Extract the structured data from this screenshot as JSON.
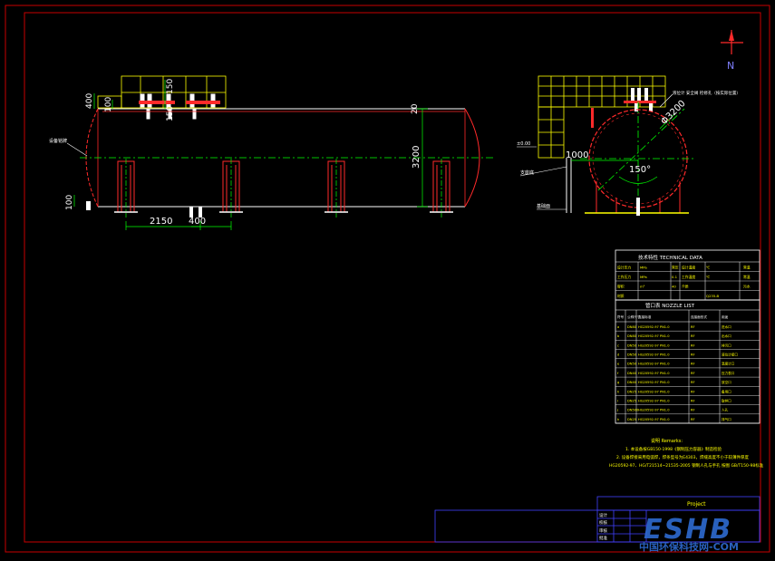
{
  "colors": {
    "background": "#000000",
    "frame": "#c80000",
    "vessel": "#ffffff",
    "support": "#ff2a2a",
    "dimension": "#00ff00",
    "table": "#ffff00",
    "centerline": "#00ff00",
    "north": "#ff2a2a",
    "text": "#ffffff",
    "watermark": "#2e6bd1"
  },
  "north": {
    "label": "N"
  },
  "side_view": {
    "dim_400_left": "400",
    "dim_100_top": "100",
    "dim_150_a": "150",
    "dim_150_b": "150",
    "dim_20": "20",
    "dim_3200": "3200",
    "dim_100_bottom": "100",
    "dim_2150": "2150",
    "dim_400_bottom": "400",
    "left_note": "设备铭牌"
  },
  "end_view": {
    "dim_diameter": "Φ3200",
    "dim_1000": "1000",
    "angle": "150°",
    "top_note": "液位计  安全阀  检修孔（按实际位置）",
    "left_note_a": "±0.00",
    "left_note_b": "支座底",
    "left_note_c": "基础面"
  },
  "technical_data": {
    "title": "技术特性  TECHNICAL DATA",
    "rows": [
      [
        "设计压力",
        "MPa",
        "常压",
        "设计温度",
        "℃",
        "常温"
      ],
      [
        "工作压力",
        "MPa",
        "0.1",
        "工作温度",
        "℃",
        "常温"
      ],
      [
        "容积",
        "m³",
        "40",
        "介质",
        "",
        "污水"
      ],
      [
        "材质",
        "",
        "",
        "",
        "Q235-B",
        ""
      ]
    ]
  },
  "nozzle_list": {
    "title": "管口表  NOZZLE LIST",
    "headers": [
      "符号",
      "公称尺寸",
      "连接标准",
      "连接面形式",
      "用途"
    ],
    "rows": [
      [
        "a",
        "DN80",
        "HG20592-97 PN1.0",
        "RF",
        "进水口"
      ],
      [
        "b",
        "DN80",
        "HG20592-97 PN1.0",
        "RF",
        "出水口"
      ],
      [
        "c",
        "DN50",
        "HG20592-97 PN1.0",
        "RF",
        "排污口"
      ],
      [
        "d",
        "DN50",
        "HG20592-97 PN1.0",
        "RF",
        "液位计接口"
      ],
      [
        "e",
        "DN50",
        "HG20592-97 PN1.0",
        "RF",
        "温度计口"
      ],
      [
        "f",
        "DN40",
        "HG20592-97 PN1.0",
        "RF",
        "压力表口"
      ],
      [
        "g",
        "DN40",
        "HG20592-97 PN1.0",
        "RF",
        "放空口"
      ],
      [
        "h",
        "DN25",
        "HG20592-97 PN1.0",
        "RF",
        "备用口"
      ],
      [
        "i",
        "DN25",
        "HG20592-97 PN1.0",
        "RF",
        "取样口"
      ],
      [
        "j",
        "DN500",
        "HG20592-97 PN1.0",
        "RF",
        "人孔"
      ],
      [
        "k",
        "DN25",
        "HG20592-97 PN1.0",
        "RF",
        "排气口"
      ]
    ]
  },
  "notes": {
    "title": "说明  Remarks:",
    "line1": "1. 本设备按GB150-1998《钢制压力容器》制造检验",
    "line2": "2. 设备焊接采用电弧焊，焊条型号为E4303，焊缝高度不小于较薄件厚度",
    "line3": "HG20592-97、HG/T21514~21535-2005 钢制人孔与手孔 按图 GB/T150-98标准"
  },
  "title_block": {
    "project": "Project",
    "cells": [
      "设计",
      "校核",
      "审核",
      "批准"
    ]
  },
  "watermark": {
    "logo": "ESHB",
    "site": "中国环保科技网-COM"
  }
}
